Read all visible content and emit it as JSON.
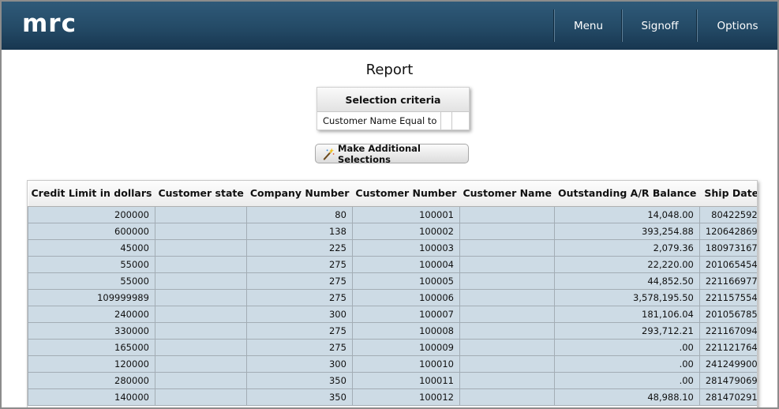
{
  "app": {
    "logo": "mrc"
  },
  "nav": {
    "menu": "Menu",
    "signoff": "Signoff",
    "options": "Options"
  },
  "page": {
    "title": "Report"
  },
  "criteria": {
    "heading": "Selection criteria",
    "field": "Customer Name Equal to",
    "value": "",
    "value2": ""
  },
  "actions": {
    "additional_selections": "Make Additional Selections",
    "icon": "magic-wand-icon"
  },
  "table": {
    "columns": [
      "Credit Limit in dollars",
      "Customer state",
      "Company Number",
      "Customer Number",
      "Customer Name",
      "Outstanding A/R Balance",
      "Ship Date"
    ],
    "rows": [
      [
        "200000",
        "",
        "80",
        "100001",
        "",
        "14,048.00",
        "80422592"
      ],
      [
        "600000",
        "",
        "138",
        "100002",
        "",
        "393,254.88",
        "120642869"
      ],
      [
        "45000",
        "",
        "225",
        "100003",
        "",
        "2,079.36",
        "180973167"
      ],
      [
        "55000",
        "",
        "275",
        "100004",
        "",
        "22,220.00",
        "201065454"
      ],
      [
        "55000",
        "",
        "275",
        "100005",
        "",
        "44,852.50",
        "221166977"
      ],
      [
        "109999989",
        "",
        "275",
        "100006",
        "",
        "3,578,195.50",
        "221157554"
      ],
      [
        "240000",
        "",
        "300",
        "100007",
        "",
        "181,106.04",
        "201056785"
      ],
      [
        "330000",
        "",
        "275",
        "100008",
        "",
        "293,712.21",
        "221167094"
      ],
      [
        "165000",
        "",
        "275",
        "100009",
        "",
        ".00",
        "221121764"
      ],
      [
        "120000",
        "",
        "300",
        "100010",
        "",
        ".00",
        "241249900"
      ],
      [
        "280000",
        "",
        "350",
        "100011",
        "",
        ".00",
        "281479069"
      ],
      [
        "140000",
        "",
        "350",
        "100012",
        "",
        "48,988.10",
        "281470291"
      ]
    ]
  }
}
